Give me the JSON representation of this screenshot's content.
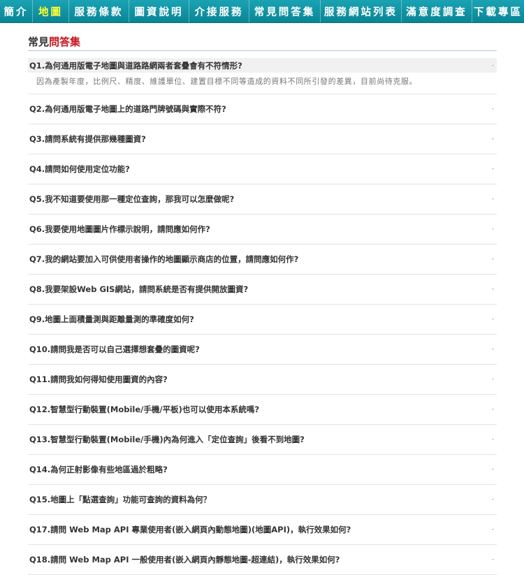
{
  "nav": {
    "items": [
      {
        "label": "簡介",
        "active": false
      },
      {
        "label": "地圖",
        "active": true
      },
      {
        "label": "服務條款",
        "active": false
      },
      {
        "label": "圖資說明",
        "active": false
      },
      {
        "label": "介接服務",
        "active": false
      },
      {
        "label": "常見問答集",
        "active": false
      },
      {
        "label": "服務網站列表",
        "active": false
      },
      {
        "label": "滿意度調查",
        "active": false
      },
      {
        "label": "下載專區",
        "active": false
      }
    ]
  },
  "section": {
    "title_prefix": "常見",
    "title_highlight": "問答集"
  },
  "faq": {
    "items": [
      {
        "q": "Q1.為何通用版電子地圖與道路路網兩者套疊會有不符情形?",
        "a": "因為產製年度，比例尺、精度、維護單位、建置目標不同等造成的資料不同所引發的差異，目前尚待克服。",
        "open": true,
        "caret": "-"
      },
      {
        "q": "Q2.為何通用版電子地圖上的道路門牌號碼與實際不符?",
        "caret": "-"
      },
      {
        "q": "Q3.請問系統有提供那幾種圖資?",
        "caret": "-"
      },
      {
        "q": "Q4.請問如何使用定位功能?",
        "caret": "-"
      },
      {
        "q": "Q5.我不知道要使用那一種定位查詢，那我可以怎麼做呢?",
        "caret": "-"
      },
      {
        "q": "Q6.我要使用地圖圖片作標示說明，請問應如何作?",
        "caret": "-"
      },
      {
        "q": "Q7.我的網站要加入可供使用者操作的地圖顯示商店的位置，請問應如何作?",
        "caret": "-"
      },
      {
        "q": "Q8.我要架設Web GIS網站，請問系統是否有提供開放圖資?",
        "caret": "-"
      },
      {
        "q": "Q9.地圖上面積量測與距離量測的準確度如何?",
        "caret": "-"
      },
      {
        "q": "Q10.請問我是否可以自己選擇想套疊的圖資呢?",
        "caret": "-"
      },
      {
        "q": "Q11.請問我如何得知使用圖資的內容?",
        "caret": "-"
      },
      {
        "q": "Q12.智慧型行動裝置(Mobile/手機/平板)也可以使用本系統嗎?",
        "caret": "-"
      },
      {
        "q": "Q13.智慧型行動裝置(Mobile/手機)內為何進入「定位查詢」後看不到地圖?",
        "caret": "-"
      },
      {
        "q": "Q14.為何正射影像有些地區過於粗略?",
        "caret": "-"
      },
      {
        "q": "Q15.地圖上「點選查詢」功能可查詢的資料為何？",
        "caret": "-"
      },
      {
        "q": "Q17.請問 Web Map API 專業使用者(嵌入網頁內動態地圖)(地圖API)，執行效果如何?",
        "caret": "-"
      },
      {
        "q": "Q18.請問 Web Map API 一般使用者(嵌入網頁內靜態地圖-超連結)，執行效果如何?",
        "caret": "-"
      }
    ]
  }
}
